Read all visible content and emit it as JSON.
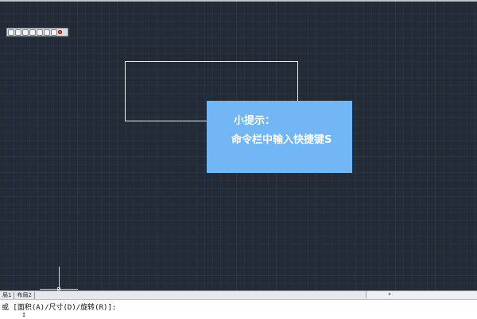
{
  "tip": {
    "title": "小提示：",
    "text": "命令栏中输入快捷键S"
  },
  "layout_tabs": [
    "局1",
    "布局2"
  ],
  "command": {
    "prompt_line": "或 [面积(A)/尺寸(D)/旋转(R)]:",
    "cursor": "I"
  },
  "toolbar": {
    "buttons": [
      "zoom-window-icon",
      "zoom-in-icon",
      "zoom-out-icon",
      "zoom-extents-icon",
      "zoom-previous-icon",
      "pan-icon",
      "close-icon"
    ]
  },
  "colors": {
    "canvas_bg": "#232b37",
    "tip_bg": "#72b6f5",
    "rect_stroke": "#e8ecf0"
  },
  "scrollbar_arrow": "◂"
}
